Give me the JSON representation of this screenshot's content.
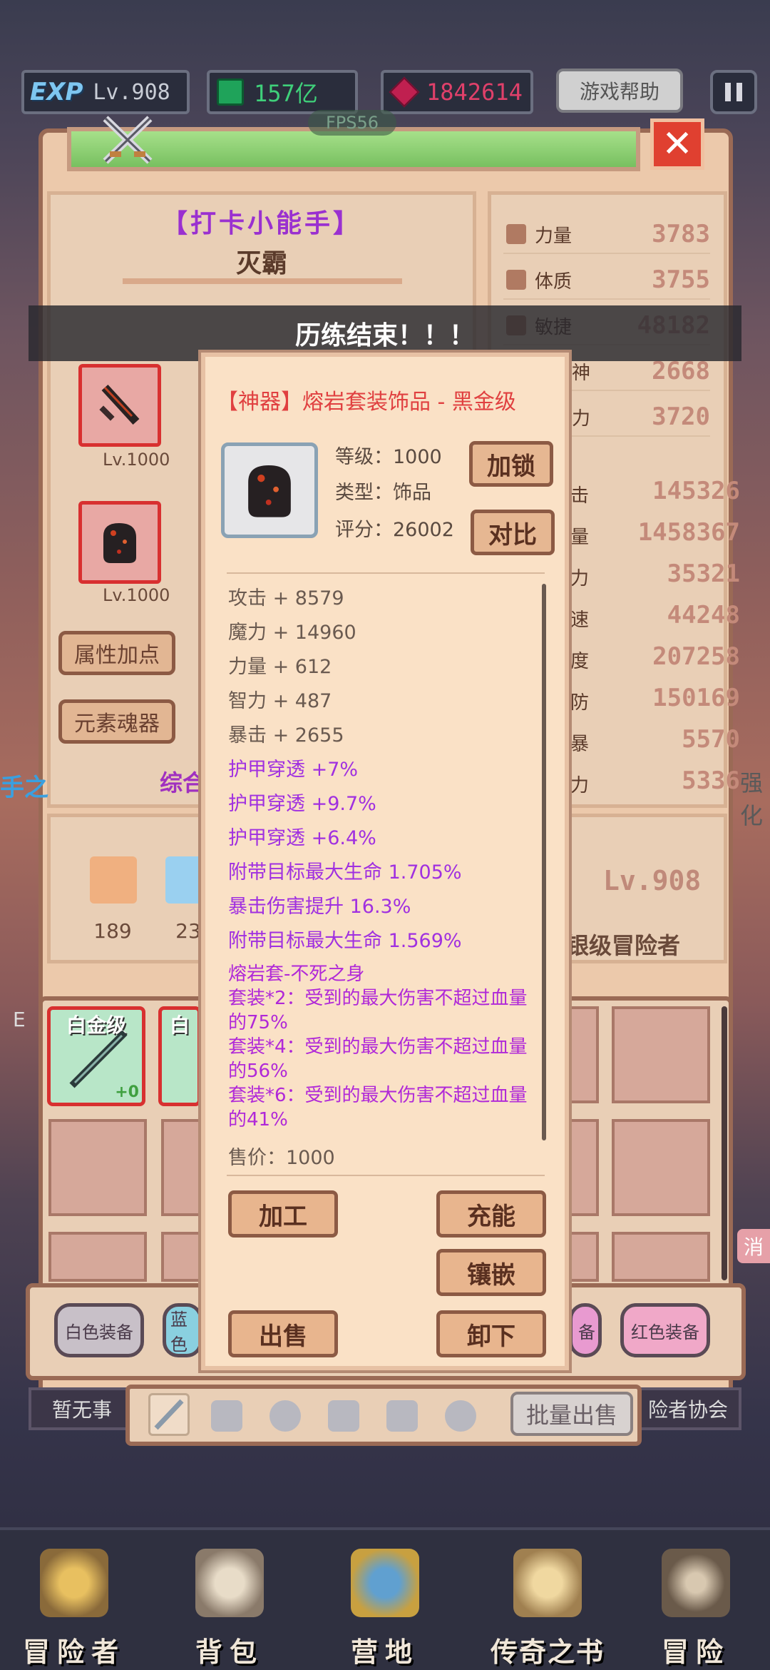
{
  "topbar": {
    "exp_logo": "EXP",
    "exp_level": "Lv.908",
    "gem_value": "157亿",
    "ruby_value": "1842614",
    "help_label": "游戏帮助",
    "fps": "FPS56"
  },
  "hero": {
    "title": "【打卡小能手】",
    "name": "灭霸",
    "weapon_level": "Lv.1000",
    "accessory_level": "Lv.1000",
    "attr_points_btn": "属性加点",
    "element_soul_btn": "元素魂器",
    "overall_label": "综合",
    "potions": [
      "189",
      "23"
    ],
    "level_right": "Lv.908",
    "rank_right": "银级冒险者",
    "left_edge_text": "手之",
    "right_edge_text": "强化"
  },
  "stats": [
    {
      "label": "力量",
      "value": "3783"
    },
    {
      "label": "体质",
      "value": "3755"
    },
    {
      "label": "敏捷",
      "value": "48182"
    },
    {
      "label": "神",
      "value": "2668"
    },
    {
      "label": "力",
      "value": "3720"
    }
  ],
  "stats2": [
    {
      "label": "击",
      "value": "145326"
    },
    {
      "label": "量",
      "value": "1458367"
    },
    {
      "label": "力",
      "value": "35321"
    },
    {
      "label": "速",
      "value": "44248"
    },
    {
      "label": "度",
      "value": "207258"
    },
    {
      "label": "防",
      "value": "150169"
    },
    {
      "label": "暴",
      "value": "5570"
    },
    {
      "label": "力",
      "value": "5336"
    }
  ],
  "toast": "历练结束！！！",
  "popup": {
    "title": "【神器】熔岩套装饰品 - 黑金级",
    "level": "等级：1000",
    "type": "类型：饰品",
    "score": "评分：26002",
    "lock_btn": "加锁",
    "compare_btn": "对比",
    "attrs_grey": [
      "攻击 + 8579",
      "魔力 + 14960",
      "力量 + 612",
      "智力 + 487",
      "暴击 + 2655"
    ],
    "attrs_purple": [
      "护甲穿透 +7%",
      "护甲穿透 +9.7%",
      "护甲穿透 +6.4%",
      "附带目标最大生命 1.705%",
      "暴击伤害提升 16.3%",
      "附带目标最大生命 1.569%"
    ],
    "set_lines": [
      "熔岩套-不死之身",
      "套装*2：受到的最大伤害不超过血量的75%",
      "套装*4：受到的最大伤害不超过血量的56%",
      "套装*6：受到的最大伤害不超过血量的41%"
    ],
    "sell_price": "售价：1000",
    "btn_process": "加工",
    "btn_charge": "充能",
    "btn_inlay": "镶嵌",
    "btn_sell": "出售",
    "btn_unequip": "卸下"
  },
  "inventory": {
    "item1_label": "白金级",
    "item1_plus": "+0",
    "item2_label": "白",
    "left_edge": "E",
    "right_tag": "消"
  },
  "filters": [
    "白色装备",
    "蓝色",
    "备",
    "红色装备"
  ],
  "tabs": {
    "left": "暂无事",
    "right": "险者协会",
    "batch_sell": "批量出售"
  },
  "nav": [
    "冒险者",
    "背包",
    "营地",
    "传奇之书",
    "冒险"
  ],
  "colors": {
    "accent_purple": "#9a30d0",
    "legend_red": "#e04040",
    "affix_purple": "#a030e0"
  }
}
